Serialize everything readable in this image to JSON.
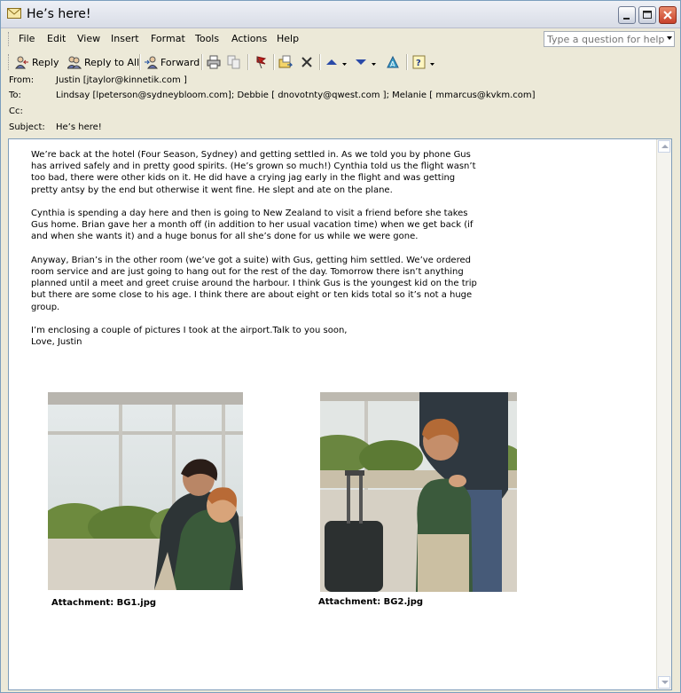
{
  "window": {
    "title": "He’s here!"
  },
  "menu": [
    "File",
    "Edit",
    "View",
    "Insert",
    "Format",
    "Tools",
    "Actions",
    "Help"
  ],
  "help_search": {
    "placeholder": "Type a question for help"
  },
  "toolbar": {
    "reply": "Reply",
    "reply_all": "Reply to All",
    "forward": "Forward"
  },
  "headers": {
    "from_label": "From:",
    "from_value": "Justin [jtaylor@kinnetik.com ]",
    "to_label": "To:",
    "to_value": "Lindsay [lpeterson@sydneybloom.com]; Debbie [ dnovotnty@qwest.com ]; Melanie [ mmarcus@kvkm.com]",
    "cc_label": "Cc:",
    "cc_value": "",
    "subject_label": "Subject:",
    "subject_value": "He’s here!"
  },
  "message": {
    "paragraphs": [
      "We’re back at the hotel (Four Season, Sydney) and getting settled in. As we told you by phone Gus has arrived safely and in pretty good spirits. (He’s grown so much!) Cynthia told us the flight wasn’t too bad, there were other kids on it. He did have a crying jag early in the flight and was getting pretty antsy by the end but otherwise it went fine. He slept and ate on the plane.",
      "Cynthia is spending a day here and then is going to New Zealand to visit a friend before she takes Gus home. Brian gave her a month off (in addition to her usual vacation time) when we get back (if and when she wants it) and a huge bonus for all she’s done for us while we were gone.",
      "Anyway, Brian’s in the other room (we’ve got a suite) with Gus, getting him settled. We’ve ordered room service and are just going to hang out for the rest of the day. Tomorrow there isn’t anything planned until a meet and greet cruise around the harbour. I think Gus is the youngest kid on the trip but there are some close to his age. I think there are about eight or ten kids total so it’s not a huge group.",
      "I’m enclosing a couple of pictures I took at the airport.Talk to you soon,",
      "Love, Justin"
    ]
  },
  "attachments": [
    {
      "label": "Attachment: BG1.jpg"
    },
    {
      "label": "Attachment: BG2.jpg"
    }
  ],
  "colors": {
    "window_bg": "#ece9d8",
    "body_bg": "#ffffff",
    "close_red": "#c8412a"
  }
}
